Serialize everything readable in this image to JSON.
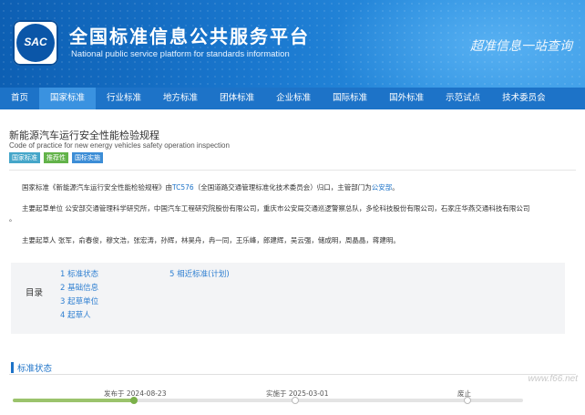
{
  "header": {
    "logo_text": "SAC",
    "title": "全国标准信息公共服务平台",
    "subtitle": "National public service platform  for standards information",
    "slogan": "超准信息一站查询"
  },
  "nav": {
    "items": [
      "首页",
      "国家标准",
      "行业标准",
      "地方标准",
      "团体标准",
      "企业标准",
      "国际标准",
      "国外标准",
      "示范试点",
      "技术委员会"
    ],
    "active_index": 1
  },
  "standard": {
    "title": "新能源汽车运行安全性能检验规程",
    "title_en": "Code of practice for new energy vehicles safety operation inspection",
    "tags": [
      "国家标准",
      "推荐性",
      "国标实施"
    ],
    "intro_prefix": "国家标准《新能源汽车运行安全性能检验规程》由",
    "tc_code": "TC576",
    "intro_mid": "（全国道路交通管理标准化技术委员会）归口，主管部门为",
    "authority": "公安部",
    "intro_end": "。",
    "drafting_units_line": "主要起草单位 公安部交通管理科学研究所，中国汽车工程研究院股份有限公司，重庆市公安局交通巡逻警察总队，多伦科技股份有限公司，石家庄华燕交通科技有限公司",
    "drafting_units_tail": "。",
    "drafters_line": "主要起草人 张军，俞春俊，穆文浩，张宏涛，孙辉，林昊舟，冉一同，王乐峰，郎建辉，吴云强，储成明，周晶晶，蒋建明。"
  },
  "toc": {
    "label": "目录",
    "items": [
      "1  标准状态",
      "2  基础信息",
      "3  起草单位",
      "4  起草人"
    ],
    "right_items": [
      "5  相近标准(计划)"
    ]
  },
  "status": {
    "heading": "标准状态",
    "publish_label": "发布于 2024-08-23",
    "implement_label": "实施于 2025-03-01",
    "abolish_label": "废止"
  },
  "watermark": "www.f66.net",
  "colors": {
    "accent": "#1d73c8",
    "banner": "#1a78cf",
    "timeline_done": "#9bc36c"
  }
}
